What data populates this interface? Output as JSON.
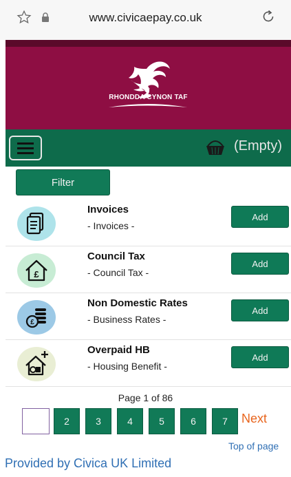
{
  "browser": {
    "url": "www.civicaepay.co.uk"
  },
  "header": {
    "logo_text": "RHONDDA CYNON TAF",
    "basket_label": "(Empty)"
  },
  "filter_label": "Filter",
  "items": [
    {
      "title": "Invoices",
      "subtitle": "- Invoices -",
      "add_label": "Add",
      "icon": "invoice-icon"
    },
    {
      "title": "Council Tax",
      "subtitle": "- Council Tax -",
      "add_label": "Add",
      "icon": "house-pound-icon"
    },
    {
      "title": "Non Domestic Rates",
      "subtitle": "- Business Rates -",
      "add_label": "Add",
      "icon": "coins-pound-icon"
    },
    {
      "title": "Overpaid HB",
      "subtitle": "- Housing Benefit -",
      "add_label": "Add",
      "icon": "house-plus-icon"
    }
  ],
  "pagination": {
    "info": "Page 1 of 86",
    "pages": [
      "2",
      "3",
      "4",
      "5",
      "6",
      "7"
    ],
    "next_label": "Next"
  },
  "footer": {
    "top_link": "Top of page",
    "provided": "Provided by Civica UK Limited"
  },
  "colors": {
    "banner": "#8e0e43",
    "nav": "#0e6b4b",
    "button": "#117a57",
    "next": "#e8641c",
    "link": "#2f6fb4"
  }
}
